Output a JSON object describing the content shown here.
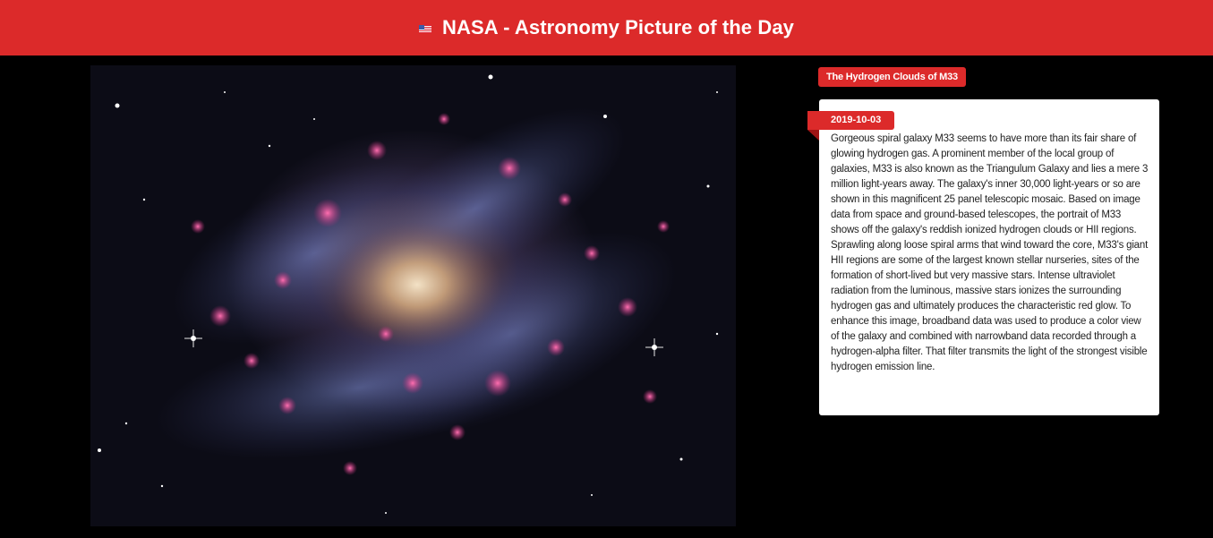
{
  "header": {
    "flag_icon": "us-flag-icon",
    "title": "NASA - Astronomy Picture of the Day"
  },
  "apod": {
    "title": "The Hydrogen Clouds of M33",
    "date": "2019-10-03",
    "explanation": "Gorgeous spiral galaxy M33 seems to have more than its fair share of glowing hydrogen gas. A prominent member of the local group of galaxies, M33 is also known as the Triangulum Galaxy and lies a mere 3 million light-years away. The galaxy's inner 30,000 light-years or so are shown in this magnificent 25 panel telescopic mosaic. Based on image data from space and ground-based telescopes, the portrait of M33 shows off the galaxy's reddish ionized hydrogen clouds or HII regions. Sprawling along loose spiral arms that wind toward the core, M33's giant HII regions are some of the largest known stellar nurseries, sites of the formation of short-lived but very massive stars. Intense ultraviolet radiation from the luminous, massive stars ionizes the surrounding hydrogen gas and ultimately produces the characteristic red glow. To enhance this image, broadband data was used to produce a color view of the galaxy and combined with narrowband data recorded through a hydrogen-alpha filter. That filter transmits the light of the strongest visible hydrogen emission line."
  },
  "colors": {
    "accent": "#dc2a2a",
    "background": "#000000",
    "card": "#ffffff"
  }
}
